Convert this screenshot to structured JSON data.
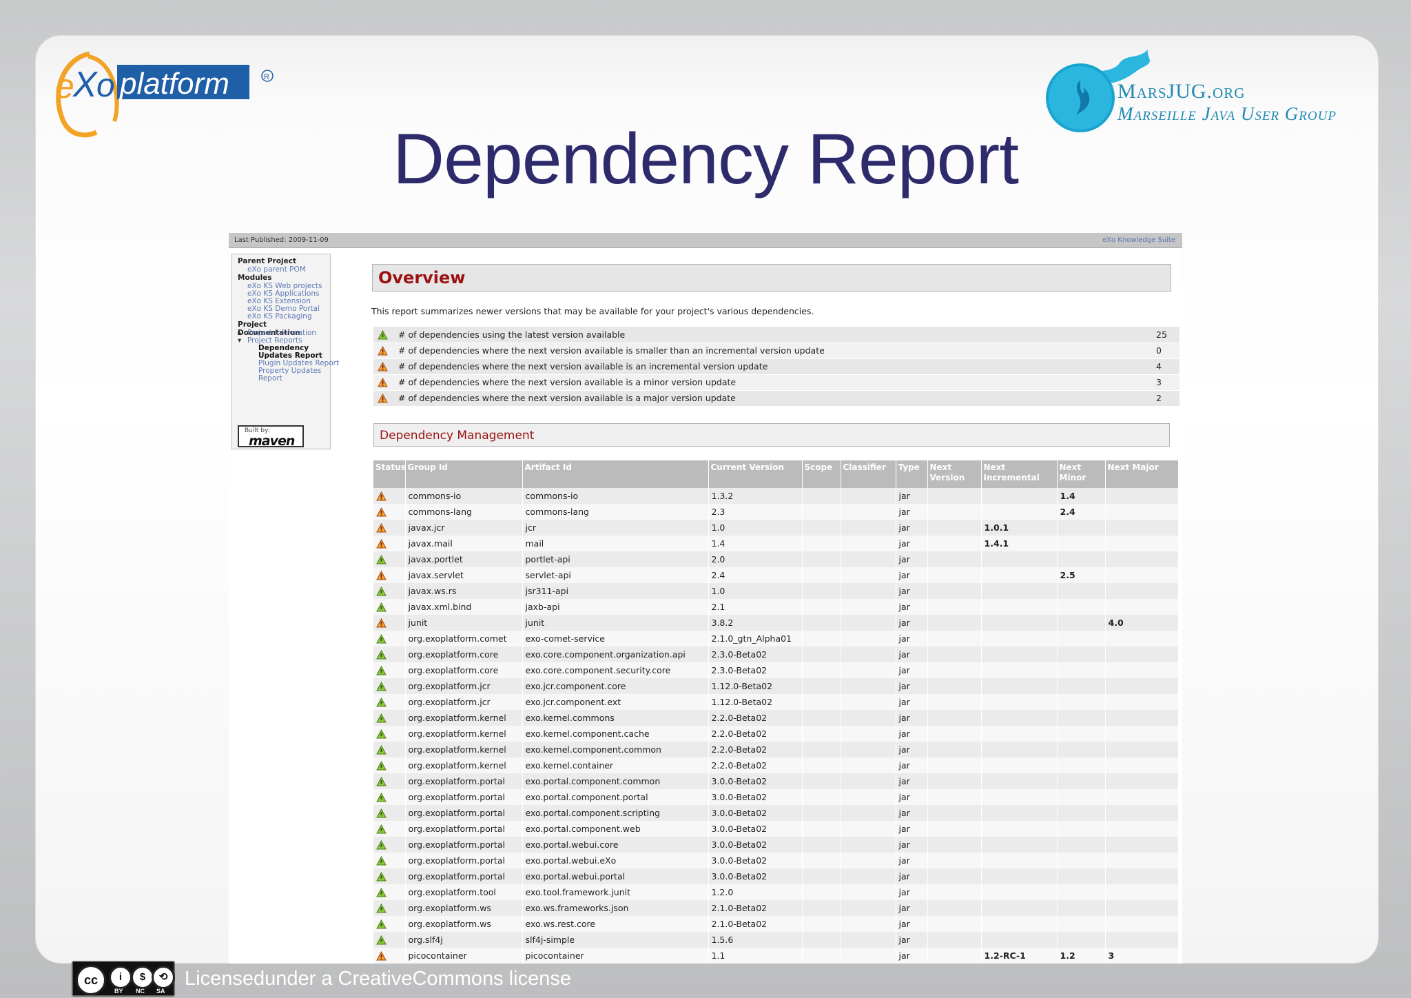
{
  "slide": {
    "title": "Dependency Report",
    "exo_logo_text": "eXo platform",
    "mars_logo": {
      "title": "MarsJUG.org",
      "subtitle": "Marseille Java User Group"
    },
    "license": "Licensedunder a CreativeCommons license",
    "cc_icons": [
      "cc-icon",
      "by-icon",
      "nc-icon",
      "sa-icon"
    ],
    "cc_labels": [
      "BY",
      "NC",
      "SA"
    ]
  },
  "report": {
    "last_published": "Last Published: 2009-11-09",
    "top_link": "eXo Knowledge Suite",
    "sidebar": {
      "parent_project_heading": "Parent Project",
      "parent_link": "eXo parent POM",
      "modules_heading": "Modules",
      "modules": [
        "eXo KS Web projects",
        "eXo KS Applications",
        "eXo KS Extension",
        "eXo KS Demo Portal",
        "eXo KS Packaging"
      ],
      "doc_heading": "Project Documentation",
      "project_information": "Project Information",
      "project_reports": "Project Reports",
      "current_1": "Dependency",
      "current_2": "Updates Report",
      "plugin_updates": "Plugin Updates Report",
      "property_1": "Property Updates",
      "property_2": "Report",
      "maven_built_by": "Built by:",
      "maven": "maven"
    },
    "overview_title": "Overview",
    "summary_description": "This report summarizes newer versions that may be available for your project's various dependencies.",
    "summary_rows": [
      {
        "status": "ok",
        "label": "# of dependencies using the latest version available",
        "count": "25"
      },
      {
        "status": "warn",
        "label": "# of dependencies where the next version available is smaller than an incremental version update",
        "count": "0"
      },
      {
        "status": "warn",
        "label": "# of dependencies where the next version available is an incremental version update",
        "count": "4"
      },
      {
        "status": "warn",
        "label": "# of dependencies where the next version available is a minor version update",
        "count": "3"
      },
      {
        "status": "warn",
        "label": "# of dependencies where the next version available is a major version update",
        "count": "2"
      }
    ],
    "dm_title": "Dependency Management",
    "columns": [
      "Status",
      "Group Id",
      "Artifact Id",
      "Current Version",
      "Scope",
      "Classifier",
      "Type",
      "Next Version",
      "Next Incremental",
      "Next Minor",
      "Next Major"
    ],
    "rows": [
      {
        "status": "warn",
        "group": "commons-io",
        "artifact": "commons-io",
        "current": "1.3.2",
        "type": "jar",
        "next_incremental": "",
        "next_minor": "1.4",
        "next_major": ""
      },
      {
        "status": "warn",
        "group": "commons-lang",
        "artifact": "commons-lang",
        "current": "2.3",
        "type": "jar",
        "next_incremental": "",
        "next_minor": "2.4",
        "next_major": ""
      },
      {
        "status": "warn",
        "group": "javax.jcr",
        "artifact": "jcr",
        "current": "1.0",
        "type": "jar",
        "next_incremental": "1.0.1",
        "next_minor": "",
        "next_major": ""
      },
      {
        "status": "warn",
        "group": "javax.mail",
        "artifact": "mail",
        "current": "1.4",
        "type": "jar",
        "next_incremental": "1.4.1",
        "next_minor": "",
        "next_major": ""
      },
      {
        "status": "ok",
        "group": "javax.portlet",
        "artifact": "portlet-api",
        "current": "2.0",
        "type": "jar",
        "next_incremental": "",
        "next_minor": "",
        "next_major": ""
      },
      {
        "status": "warn",
        "group": "javax.servlet",
        "artifact": "servlet-api",
        "current": "2.4",
        "type": "jar",
        "next_incremental": "",
        "next_minor": "2.5",
        "next_major": ""
      },
      {
        "status": "ok",
        "group": "javax.ws.rs",
        "artifact": "jsr311-api",
        "current": "1.0",
        "type": "jar",
        "next_incremental": "",
        "next_minor": "",
        "next_major": ""
      },
      {
        "status": "ok",
        "group": "javax.xml.bind",
        "artifact": "jaxb-api",
        "current": "2.1",
        "type": "jar",
        "next_incremental": "",
        "next_minor": "",
        "next_major": ""
      },
      {
        "status": "warn",
        "group": "junit",
        "artifact": "junit",
        "current": "3.8.2",
        "type": "jar",
        "next_incremental": "",
        "next_minor": "",
        "next_major": "4.0"
      },
      {
        "status": "ok",
        "group": "org.exoplatform.comet",
        "artifact": "exo-comet-service",
        "current": "2.1.0_gtn_Alpha01",
        "type": "jar",
        "next_incremental": "",
        "next_minor": "",
        "next_major": ""
      },
      {
        "status": "ok",
        "group": "org.exoplatform.core",
        "artifact": "exo.core.component.organization.api",
        "current": "2.3.0-Beta02",
        "type": "jar",
        "next_incremental": "",
        "next_minor": "",
        "next_major": ""
      },
      {
        "status": "ok",
        "group": "org.exoplatform.core",
        "artifact": "exo.core.component.security.core",
        "current": "2.3.0-Beta02",
        "type": "jar",
        "next_incremental": "",
        "next_minor": "",
        "next_major": ""
      },
      {
        "status": "ok",
        "group": "org.exoplatform.jcr",
        "artifact": "exo.jcr.component.core",
        "current": "1.12.0-Beta02",
        "type": "jar",
        "next_incremental": "",
        "next_minor": "",
        "next_major": ""
      },
      {
        "status": "ok",
        "group": "org.exoplatform.jcr",
        "artifact": "exo.jcr.component.ext",
        "current": "1.12.0-Beta02",
        "type": "jar",
        "next_incremental": "",
        "next_minor": "",
        "next_major": ""
      },
      {
        "status": "ok",
        "group": "org.exoplatform.kernel",
        "artifact": "exo.kernel.commons",
        "current": "2.2.0-Beta02",
        "type": "jar",
        "next_incremental": "",
        "next_minor": "",
        "next_major": ""
      },
      {
        "status": "ok",
        "group": "org.exoplatform.kernel",
        "artifact": "exo.kernel.component.cache",
        "current": "2.2.0-Beta02",
        "type": "jar",
        "next_incremental": "",
        "next_minor": "",
        "next_major": ""
      },
      {
        "status": "ok",
        "group": "org.exoplatform.kernel",
        "artifact": "exo.kernel.component.common",
        "current": "2.2.0-Beta02",
        "type": "jar",
        "next_incremental": "",
        "next_minor": "",
        "next_major": ""
      },
      {
        "status": "ok",
        "group": "org.exoplatform.kernel",
        "artifact": "exo.kernel.container",
        "current": "2.2.0-Beta02",
        "type": "jar",
        "next_incremental": "",
        "next_minor": "",
        "next_major": ""
      },
      {
        "status": "ok",
        "group": "org.exoplatform.portal",
        "artifact": "exo.portal.component.common",
        "current": "3.0.0-Beta02",
        "type": "jar",
        "next_incremental": "",
        "next_minor": "",
        "next_major": ""
      },
      {
        "status": "ok",
        "group": "org.exoplatform.portal",
        "artifact": "exo.portal.component.portal",
        "current": "3.0.0-Beta02",
        "type": "jar",
        "next_incremental": "",
        "next_minor": "",
        "next_major": ""
      },
      {
        "status": "ok",
        "group": "org.exoplatform.portal",
        "artifact": "exo.portal.component.scripting",
        "current": "3.0.0-Beta02",
        "type": "jar",
        "next_incremental": "",
        "next_minor": "",
        "next_major": ""
      },
      {
        "status": "ok",
        "group": "org.exoplatform.portal",
        "artifact": "exo.portal.component.web",
        "current": "3.0.0-Beta02",
        "type": "jar",
        "next_incremental": "",
        "next_minor": "",
        "next_major": ""
      },
      {
        "status": "ok",
        "group": "org.exoplatform.portal",
        "artifact": "exo.portal.webui.core",
        "current": "3.0.0-Beta02",
        "type": "jar",
        "next_incremental": "",
        "next_minor": "",
        "next_major": ""
      },
      {
        "status": "ok",
        "group": "org.exoplatform.portal",
        "artifact": "exo.portal.webui.eXo",
        "current": "3.0.0-Beta02",
        "type": "jar",
        "next_incremental": "",
        "next_minor": "",
        "next_major": ""
      },
      {
        "status": "ok",
        "group": "org.exoplatform.portal",
        "artifact": "exo.portal.webui.portal",
        "current": "3.0.0-Beta02",
        "type": "jar",
        "next_incremental": "",
        "next_minor": "",
        "next_major": ""
      },
      {
        "status": "ok",
        "group": "org.exoplatform.tool",
        "artifact": "exo.tool.framework.junit",
        "current": "1.2.0",
        "type": "jar",
        "next_incremental": "",
        "next_minor": "",
        "next_major": ""
      },
      {
        "status": "ok",
        "group": "org.exoplatform.ws",
        "artifact": "exo.ws.frameworks.json",
        "current": "2.1.0-Beta02",
        "type": "jar",
        "next_incremental": "",
        "next_minor": "",
        "next_major": ""
      },
      {
        "status": "ok",
        "group": "org.exoplatform.ws",
        "artifact": "exo.ws.rest.core",
        "current": "2.1.0-Beta02",
        "type": "jar",
        "next_incremental": "",
        "next_minor": "",
        "next_major": ""
      },
      {
        "status": "ok",
        "group": "org.slf4j",
        "artifact": "slf4j-simple",
        "current": "1.5.6",
        "type": "jar",
        "next_incremental": "",
        "next_minor": "",
        "next_major": ""
      },
      {
        "status": "warn",
        "group": "picocontainer",
        "artifact": "picocontainer",
        "current": "1.1",
        "type": "jar",
        "next_incremental": "1.2-RC-1",
        "next_minor": "1.2",
        "next_major": "3"
      }
    ]
  },
  "colors": {
    "title": "#2d2b6b",
    "report_heading": "#9b1111",
    "link": "#5d79b5",
    "mars": "#2189b3",
    "exo_blue": "#1f5fa8",
    "exo_orange": "#f2a224"
  }
}
